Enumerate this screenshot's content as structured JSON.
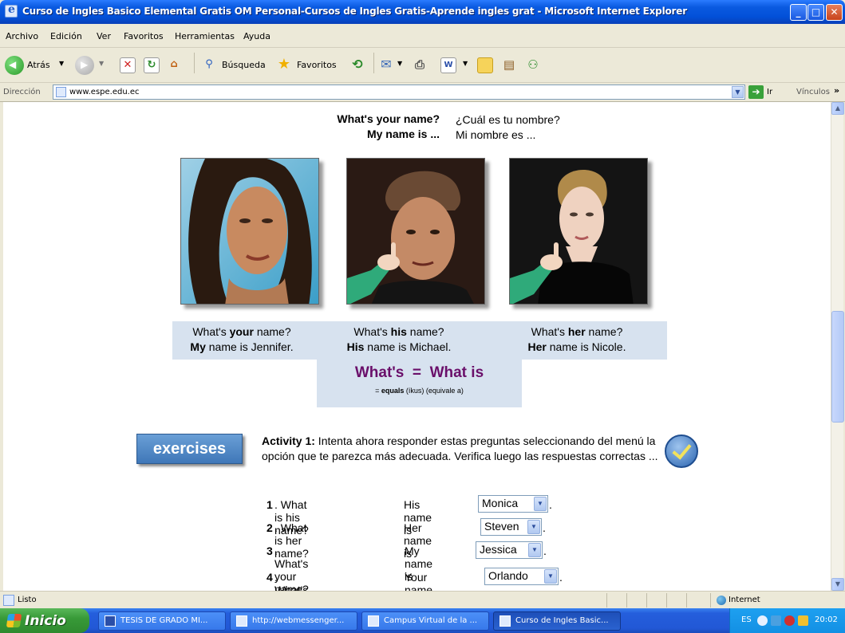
{
  "window": {
    "title": "Curso de Ingles Basico Elemental Gratis OM Personal-Cursos de Ingles Gratis-Aprende ingles grat - Microsoft Internet Explorer",
    "min": "_",
    "max": "□",
    "close": "✕"
  },
  "menu": [
    "Archivo",
    "Edición",
    "Ver",
    "Favoritos",
    "Herramientas",
    "Ayuda"
  ],
  "toolbar": {
    "back": "Atrás",
    "search": "Búsqueda",
    "favorites": "Favoritos"
  },
  "address": {
    "label": "Dirección",
    "value": "www.espe.edu.ec",
    "go": "Ir",
    "links": "Vínculos"
  },
  "page": {
    "q1": "What's your name?",
    "a1": "¿Cuál es tu nombre?",
    "q2": "My name is ...",
    "a2": "Mi nombre es ...",
    "captions": [
      {
        "l1a": "What's ",
        "l1b": "your",
        "l1c": " name?",
        "l2a": "My",
        "l2b": " name is Jennifer."
      },
      {
        "l1a": "What's ",
        "l1b": "his",
        "l1c": " name?",
        "l2a": "His",
        "l2b": " name is Michael."
      },
      {
        "l1a": "What's ",
        "l1b": "her",
        "l1c": " name?",
        "l2a": "Her",
        "l2b": " name is Nicole."
      }
    ],
    "equals_title": "What's  =  What is",
    "equals_sub_a": "= ",
    "equals_sub_b": "equals",
    "equals_sub_c": " (íkus) (equivale a)",
    "exercises": "exercises",
    "activity_label": "Activity 1:",
    "activity_text": " Intenta ahora responder estas preguntas seleccionando del menú la opción que te parezca más adecuada. Verifica luego las respuestas correctas ...",
    "rows": [
      {
        "num": "1",
        "q": ". What is his name?",
        "a": "His name is",
        "sel": "Monica"
      },
      {
        "num": "2",
        "q": ". What is her name?",
        "a": "Her name is",
        "sel": "Steven"
      },
      {
        "num": "3",
        "q": ". What's your name?",
        "a": "My name is",
        "sel": "Jessica"
      },
      {
        "num": "4",
        "q": ". What's my name?",
        "a": "Your name is",
        "sel": "Orlando"
      }
    ]
  },
  "status": {
    "text": "Listo",
    "zone": "Internet"
  },
  "taskbar": {
    "start": "Inicio",
    "tasks": [
      "TESIS DE GRADO MI...",
      "http://webmessenger...",
      "Campus Virtual de la ...",
      "Curso de Ingles Basic..."
    ],
    "lang": "ES",
    "clock": "20:02"
  }
}
